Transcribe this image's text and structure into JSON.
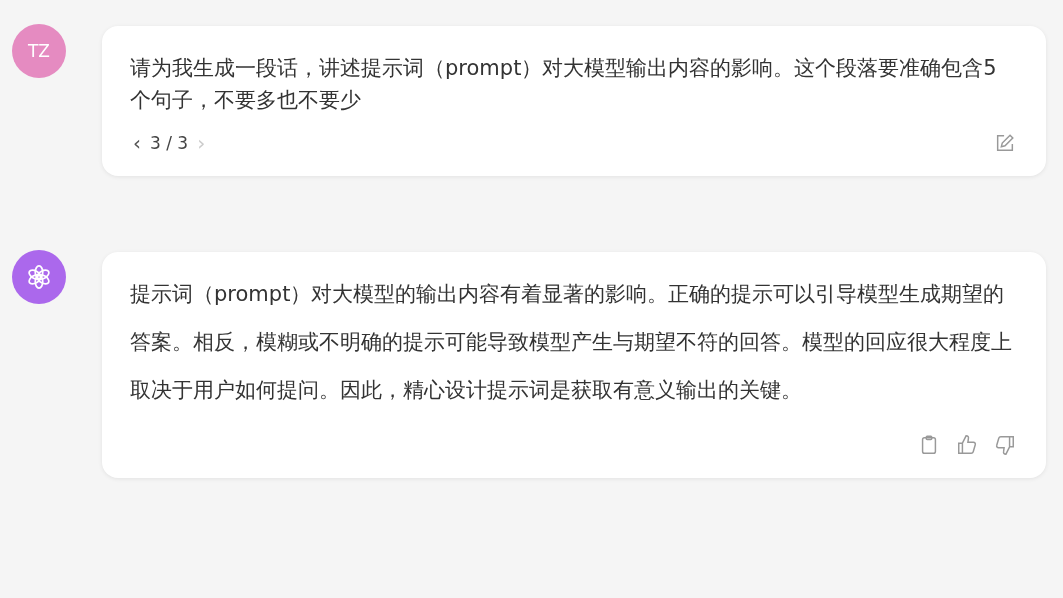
{
  "messages": [
    {
      "kind": "user",
      "avatar": "TZ",
      "text": "请为我生成一段话，讲述提示词（prompt）对大模型输出内容的影响。这个段落要准确包含5个句子，不要多也不要少",
      "pager": {
        "prev": {
          "label": "‹",
          "disabled": false
        },
        "counter": "3 / 3",
        "next": {
          "label": "›",
          "disabled": true
        }
      }
    },
    {
      "kind": "assistant",
      "text": "提示词（prompt）对大模型的输出内容有着显著的影响。正确的提示可以引导模型生成期望的答案。相反，模糊或不明确的提示可能导致模型产生与期望不符的回答。模型的回应很大程度上取决于用户如何提问。因此，精心设计提示词是获取有意义输出的关键。"
    }
  ]
}
